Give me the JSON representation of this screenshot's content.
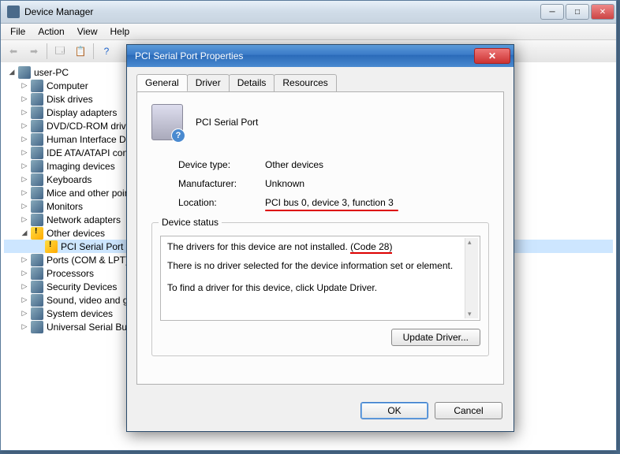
{
  "mainWindow": {
    "title": "Device Manager",
    "menus": [
      "File",
      "Action",
      "View",
      "Help"
    ]
  },
  "tree": {
    "root": "user-PC",
    "nodes": [
      {
        "label": "Computer",
        "icon": "comp"
      },
      {
        "label": "Disk drives",
        "icon": "comp"
      },
      {
        "label": "Display adapters",
        "icon": "comp"
      },
      {
        "label": "DVD/CD-ROM drives",
        "icon": "comp"
      },
      {
        "label": "Human Interface Devices",
        "icon": "comp"
      },
      {
        "label": "IDE ATA/ATAPI controllers",
        "icon": "comp"
      },
      {
        "label": "Imaging devices",
        "icon": "comp"
      },
      {
        "label": "Keyboards",
        "icon": "comp"
      },
      {
        "label": "Mice and other pointing devices",
        "icon": "comp"
      },
      {
        "label": "Monitors",
        "icon": "comp"
      },
      {
        "label": "Network adapters",
        "icon": "comp"
      }
    ],
    "otherDevices": {
      "label": "Other devices",
      "icon": "warn"
    },
    "pciSerial": {
      "label": "PCI Serial Port",
      "icon": "warn"
    },
    "nodes2": [
      {
        "label": "Ports (COM & LPT)",
        "icon": "comp"
      },
      {
        "label": "Processors",
        "icon": "comp"
      },
      {
        "label": "Security Devices",
        "icon": "comp"
      },
      {
        "label": "Sound, video and game controllers",
        "icon": "comp"
      },
      {
        "label": "System devices",
        "icon": "comp"
      },
      {
        "label": "Universal Serial Bus controllers",
        "icon": "comp"
      }
    ]
  },
  "dialog": {
    "title": "PCI Serial Port Properties",
    "tabs": [
      "General",
      "Driver",
      "Details",
      "Resources"
    ],
    "deviceName": "PCI Serial Port",
    "info": {
      "typeLabel": "Device type:",
      "typeValue": "Other devices",
      "mfrLabel": "Manufacturer:",
      "mfrValue": "Unknown",
      "locLabel": "Location:",
      "locValue": "PCI bus 0, device 3, function 3"
    },
    "statusLegend": "Device status",
    "status": {
      "line1a": "The drivers for this device are not installed. ",
      "line1b": "(Code 28)",
      "line2": "There is no driver selected for the device information set or element.",
      "line3": "To find a driver for this device, click Update Driver."
    },
    "updateBtn": "Update Driver...",
    "ok": "OK",
    "cancel": "Cancel"
  }
}
